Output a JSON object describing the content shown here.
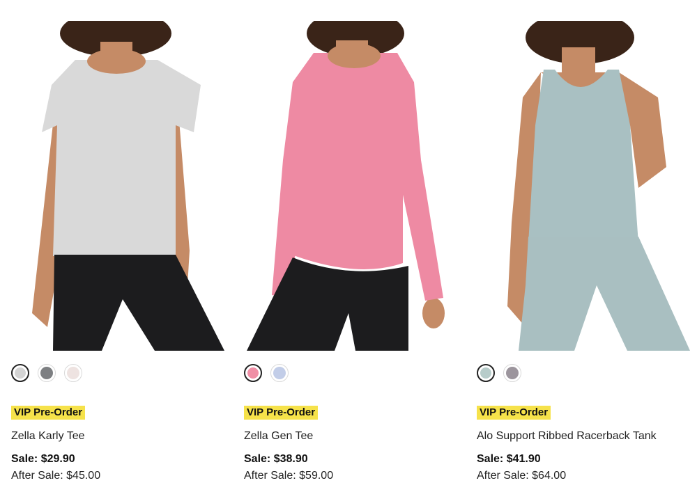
{
  "products": [
    {
      "badge": "VIP Pre-Order",
      "name": "Zella Karly Tee",
      "sale_price": "Sale: $29.90",
      "after_sale_price": "After Sale: $45.00",
      "swatches": [
        {
          "color": "#d4d4d4",
          "selected": true
        },
        {
          "color": "#7d7f82",
          "selected": false
        },
        {
          "color": "#eee3e1",
          "selected": false
        }
      ],
      "top_color": "#d9d9d9",
      "bottom_color": "#1c1c1e"
    },
    {
      "badge": "VIP Pre-Order",
      "name": "Zella Gen Tee",
      "sale_price": "Sale: $38.90",
      "after_sale_price": "After Sale: $59.00",
      "swatches": [
        {
          "color": "#f08fa6",
          "selected": true
        },
        {
          "color": "#c2cde8",
          "selected": false
        }
      ],
      "top_color": "#ee8aa3",
      "bottom_color": "#1c1c1e"
    },
    {
      "badge": "VIP Pre-Order",
      "name": "Alo Support Ribbed Racerback Tank",
      "sale_price": "Sale: $41.90",
      "after_sale_price": "After Sale: $64.00",
      "swatches": [
        {
          "color": "#b7ccca",
          "selected": true
        },
        {
          "color": "#9c959d",
          "selected": false
        }
      ],
      "top_color": "#a9c0c2",
      "bottom_color": "#a9bfc1"
    }
  ],
  "theme": {
    "badge_color": "#f6e24a",
    "skin_color": "#c58b66",
    "hair_color": "#3a2418"
  }
}
